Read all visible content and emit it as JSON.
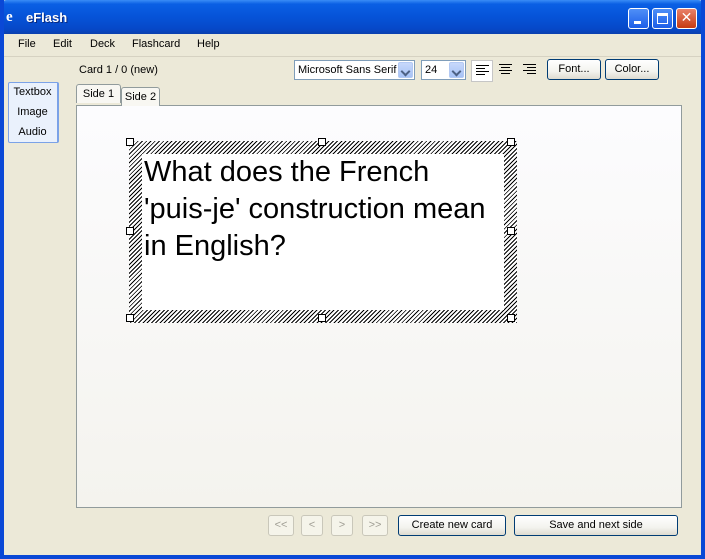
{
  "window": {
    "title": "eFlash",
    "app_icon": "e",
    "controls": {
      "minimize": "minimize-icon",
      "maximize": "maximize-icon",
      "close": "✕"
    }
  },
  "menu": {
    "items": [
      {
        "label": "File"
      },
      {
        "label": "Edit"
      },
      {
        "label": "Deck"
      },
      {
        "label": "Flashcard"
      },
      {
        "label": "Help"
      }
    ]
  },
  "tools": {
    "items": [
      {
        "label": "Textbox"
      },
      {
        "label": "Image"
      },
      {
        "label": "Audio"
      }
    ]
  },
  "card": {
    "status": "Card 1 / 0 (new)"
  },
  "format": {
    "font_name": "Microsoft Sans Serif",
    "font_size": "24",
    "align_left_icon": "align-left-icon",
    "align_center_icon": "align-center-icon",
    "align_right_icon": "align-right-icon",
    "font_button": "Font...",
    "color_button": "Color..."
  },
  "tabs": [
    {
      "label": "Side 1",
      "active": true
    },
    {
      "label": "Side 2",
      "active": false
    }
  ],
  "textbox": {
    "text": "What does the French 'puis-je' construction mean in English?"
  },
  "nav": {
    "first": "<<",
    "prev": "<",
    "next": ">",
    "last": ">>",
    "create_new_card": "Create new card",
    "save_next_side": "Save and next side"
  },
  "colors": {
    "title_bar": "#0653d8",
    "window_bg": "#ece9d8",
    "tab_highlight": "#ffc83c"
  }
}
